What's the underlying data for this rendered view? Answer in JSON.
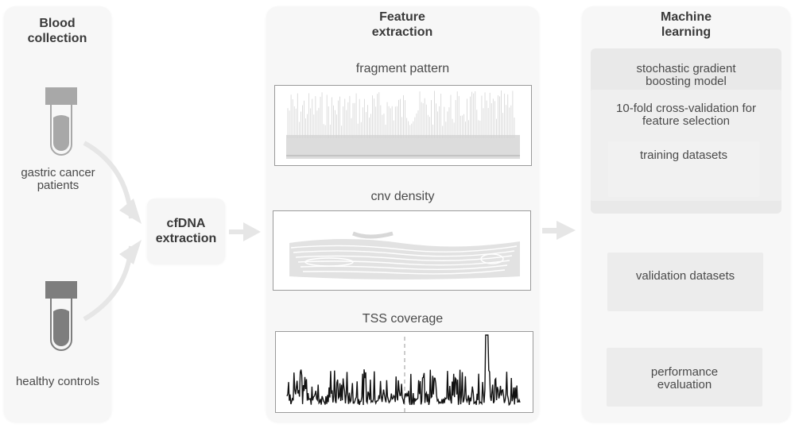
{
  "blood_collection": {
    "title": "Blood collection",
    "groups": [
      {
        "label": "gastric cancer patients",
        "icon": "blood-tube-icon",
        "cap_color": "#a8a8a8",
        "fill_color": "#a8a8a8"
      },
      {
        "label": "healthy controls",
        "icon": "blood-tube-icon",
        "cap_color": "#7e7e7e",
        "fill_color": "#7e7e7e"
      }
    ]
  },
  "cfdna": {
    "title": "cfDNA extraction"
  },
  "feature_extraction": {
    "title": "Feature extraction",
    "features": [
      {
        "label": "fragment pattern",
        "plot": "fragment-pattern-thumbnail"
      },
      {
        "label": "cnv density",
        "plot": "cnv-density-contour-thumbnail"
      },
      {
        "label": "TSS coverage",
        "plot": "tss-coverage-line-thumbnail"
      }
    ]
  },
  "machine_learning": {
    "title": "Machine learning",
    "model": "stochastic gradient boosting model",
    "cv": "10-fold cross-validation for feature selection",
    "training": "training datasets",
    "validation": "validation datasets",
    "evaluation": "performance evaluation"
  },
  "colors": {
    "panel_bg": "#f7f7f7",
    "arrow": "#e6e6e6",
    "text": "#3a3a3a",
    "tss_line": "#111111"
  }
}
